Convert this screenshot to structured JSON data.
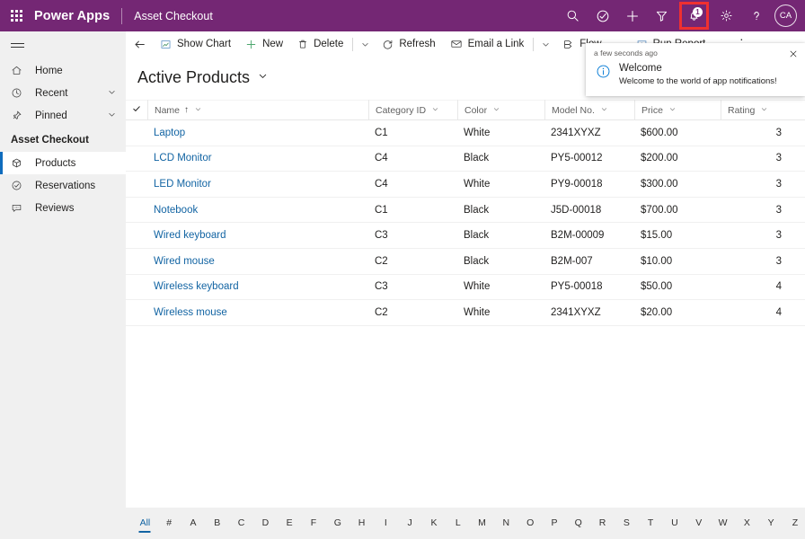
{
  "header": {
    "brand": "Power Apps",
    "app_name": "Asset Checkout",
    "waffle_name": "app-launcher",
    "actions": [
      {
        "name": "search-icon",
        "label": "Search"
      },
      {
        "name": "diagnostics-icon",
        "label": "Diagnostics"
      },
      {
        "name": "plus-icon",
        "label": "New"
      },
      {
        "name": "filter-icon",
        "label": "Filter"
      }
    ],
    "notification": {
      "name": "notification-bell-icon",
      "badge": "1",
      "highlighted": true,
      "highlight_color": "#f03030"
    },
    "settings_label": "Settings",
    "help_label": "Help",
    "avatar_initials": "CA",
    "bar_color": "#742774"
  },
  "sidebar": {
    "hamburger_label": "Site Map",
    "items": [
      {
        "label": "Home",
        "icon": "home-icon",
        "chevron": false
      },
      {
        "label": "Recent",
        "icon": "clock-icon",
        "chevron": true
      },
      {
        "label": "Pinned",
        "icon": "pin-icon",
        "chevron": true
      }
    ],
    "group_label": "Asset Checkout",
    "group_items": [
      {
        "label": "Products",
        "icon": "box-icon",
        "selected": true
      },
      {
        "label": "Reservations",
        "icon": "check-circle-icon",
        "selected": false
      },
      {
        "label": "Reviews",
        "icon": "comment-icon",
        "selected": false
      }
    ],
    "accent_color": "#0f6cbd"
  },
  "commandbar": {
    "back_label": "Back",
    "buttons": [
      {
        "label": "Show Chart",
        "icon": "chart-icon",
        "caret": false
      },
      {
        "label": "New",
        "icon": "plus-icon",
        "caret": false
      },
      {
        "label": "Delete",
        "icon": "trash-icon",
        "caret": true
      },
      {
        "label": "Refresh",
        "icon": "refresh-icon",
        "caret": false
      },
      {
        "label": "Email a Link",
        "icon": "email-icon",
        "caret": true
      },
      {
        "label": "Flow",
        "icon": "flow-icon",
        "caret": true
      },
      {
        "label": "Run Report",
        "icon": "report-icon",
        "caret": true
      }
    ],
    "overflow_label": "More commands"
  },
  "view": {
    "title": "Active Products",
    "chevron_name": "chevron-down-icon"
  },
  "grid": {
    "select_all_name": "select-all-checkbox",
    "columns": [
      {
        "label": "Name",
        "sort": "↑"
      },
      {
        "label": "Category ID",
        "sort": ""
      },
      {
        "label": "Color",
        "sort": ""
      },
      {
        "label": "Model No.",
        "sort": ""
      },
      {
        "label": "Price",
        "sort": ""
      },
      {
        "label": "Rating",
        "sort": ""
      }
    ],
    "rows": [
      {
        "name": "Laptop",
        "category": "C1",
        "color": "White",
        "model": "2341XYXZ",
        "price": "$600.00",
        "rating": "3"
      },
      {
        "name": "LCD Monitor",
        "category": "C4",
        "color": "Black",
        "model": "PY5-00012",
        "price": "$200.00",
        "rating": "3"
      },
      {
        "name": "LED Monitor",
        "category": "C4",
        "color": "White",
        "model": "PY9-00018",
        "price": "$300.00",
        "rating": "3"
      },
      {
        "name": "Notebook",
        "category": "C1",
        "color": "Black",
        "model": "J5D-00018",
        "price": "$700.00",
        "rating": "3"
      },
      {
        "name": "Wired keyboard",
        "category": "C3",
        "color": "Black",
        "model": "B2M-00009",
        "price": "$15.00",
        "rating": "3"
      },
      {
        "name": "Wired mouse",
        "category": "C2",
        "color": "Black",
        "model": "B2M-007",
        "price": "$10.00",
        "rating": "3"
      },
      {
        "name": "Wireless keyboard",
        "category": "C3",
        "color": "White",
        "model": "PY5-00018",
        "price": "$50.00",
        "rating": "4"
      },
      {
        "name": "Wireless mouse",
        "category": "C2",
        "color": "White",
        "model": "2341XYXZ",
        "price": "$20.00",
        "rating": "4"
      }
    ],
    "link_color": "#1264a3"
  },
  "notification_panel": {
    "time": "a few seconds ago",
    "close_name": "close-icon",
    "info_icon": "info-circle-icon",
    "title": "Welcome",
    "message": "Welcome to the world of app notifications!"
  },
  "alphabet_filter": {
    "items": [
      "All",
      "#",
      "A",
      "B",
      "C",
      "D",
      "E",
      "F",
      "G",
      "H",
      "I",
      "J",
      "K",
      "L",
      "M",
      "N",
      "O",
      "P",
      "Q",
      "R",
      "S",
      "T",
      "U",
      "V",
      "W",
      "X",
      "Y",
      "Z"
    ],
    "active": "All",
    "active_color": "#1264a3"
  }
}
